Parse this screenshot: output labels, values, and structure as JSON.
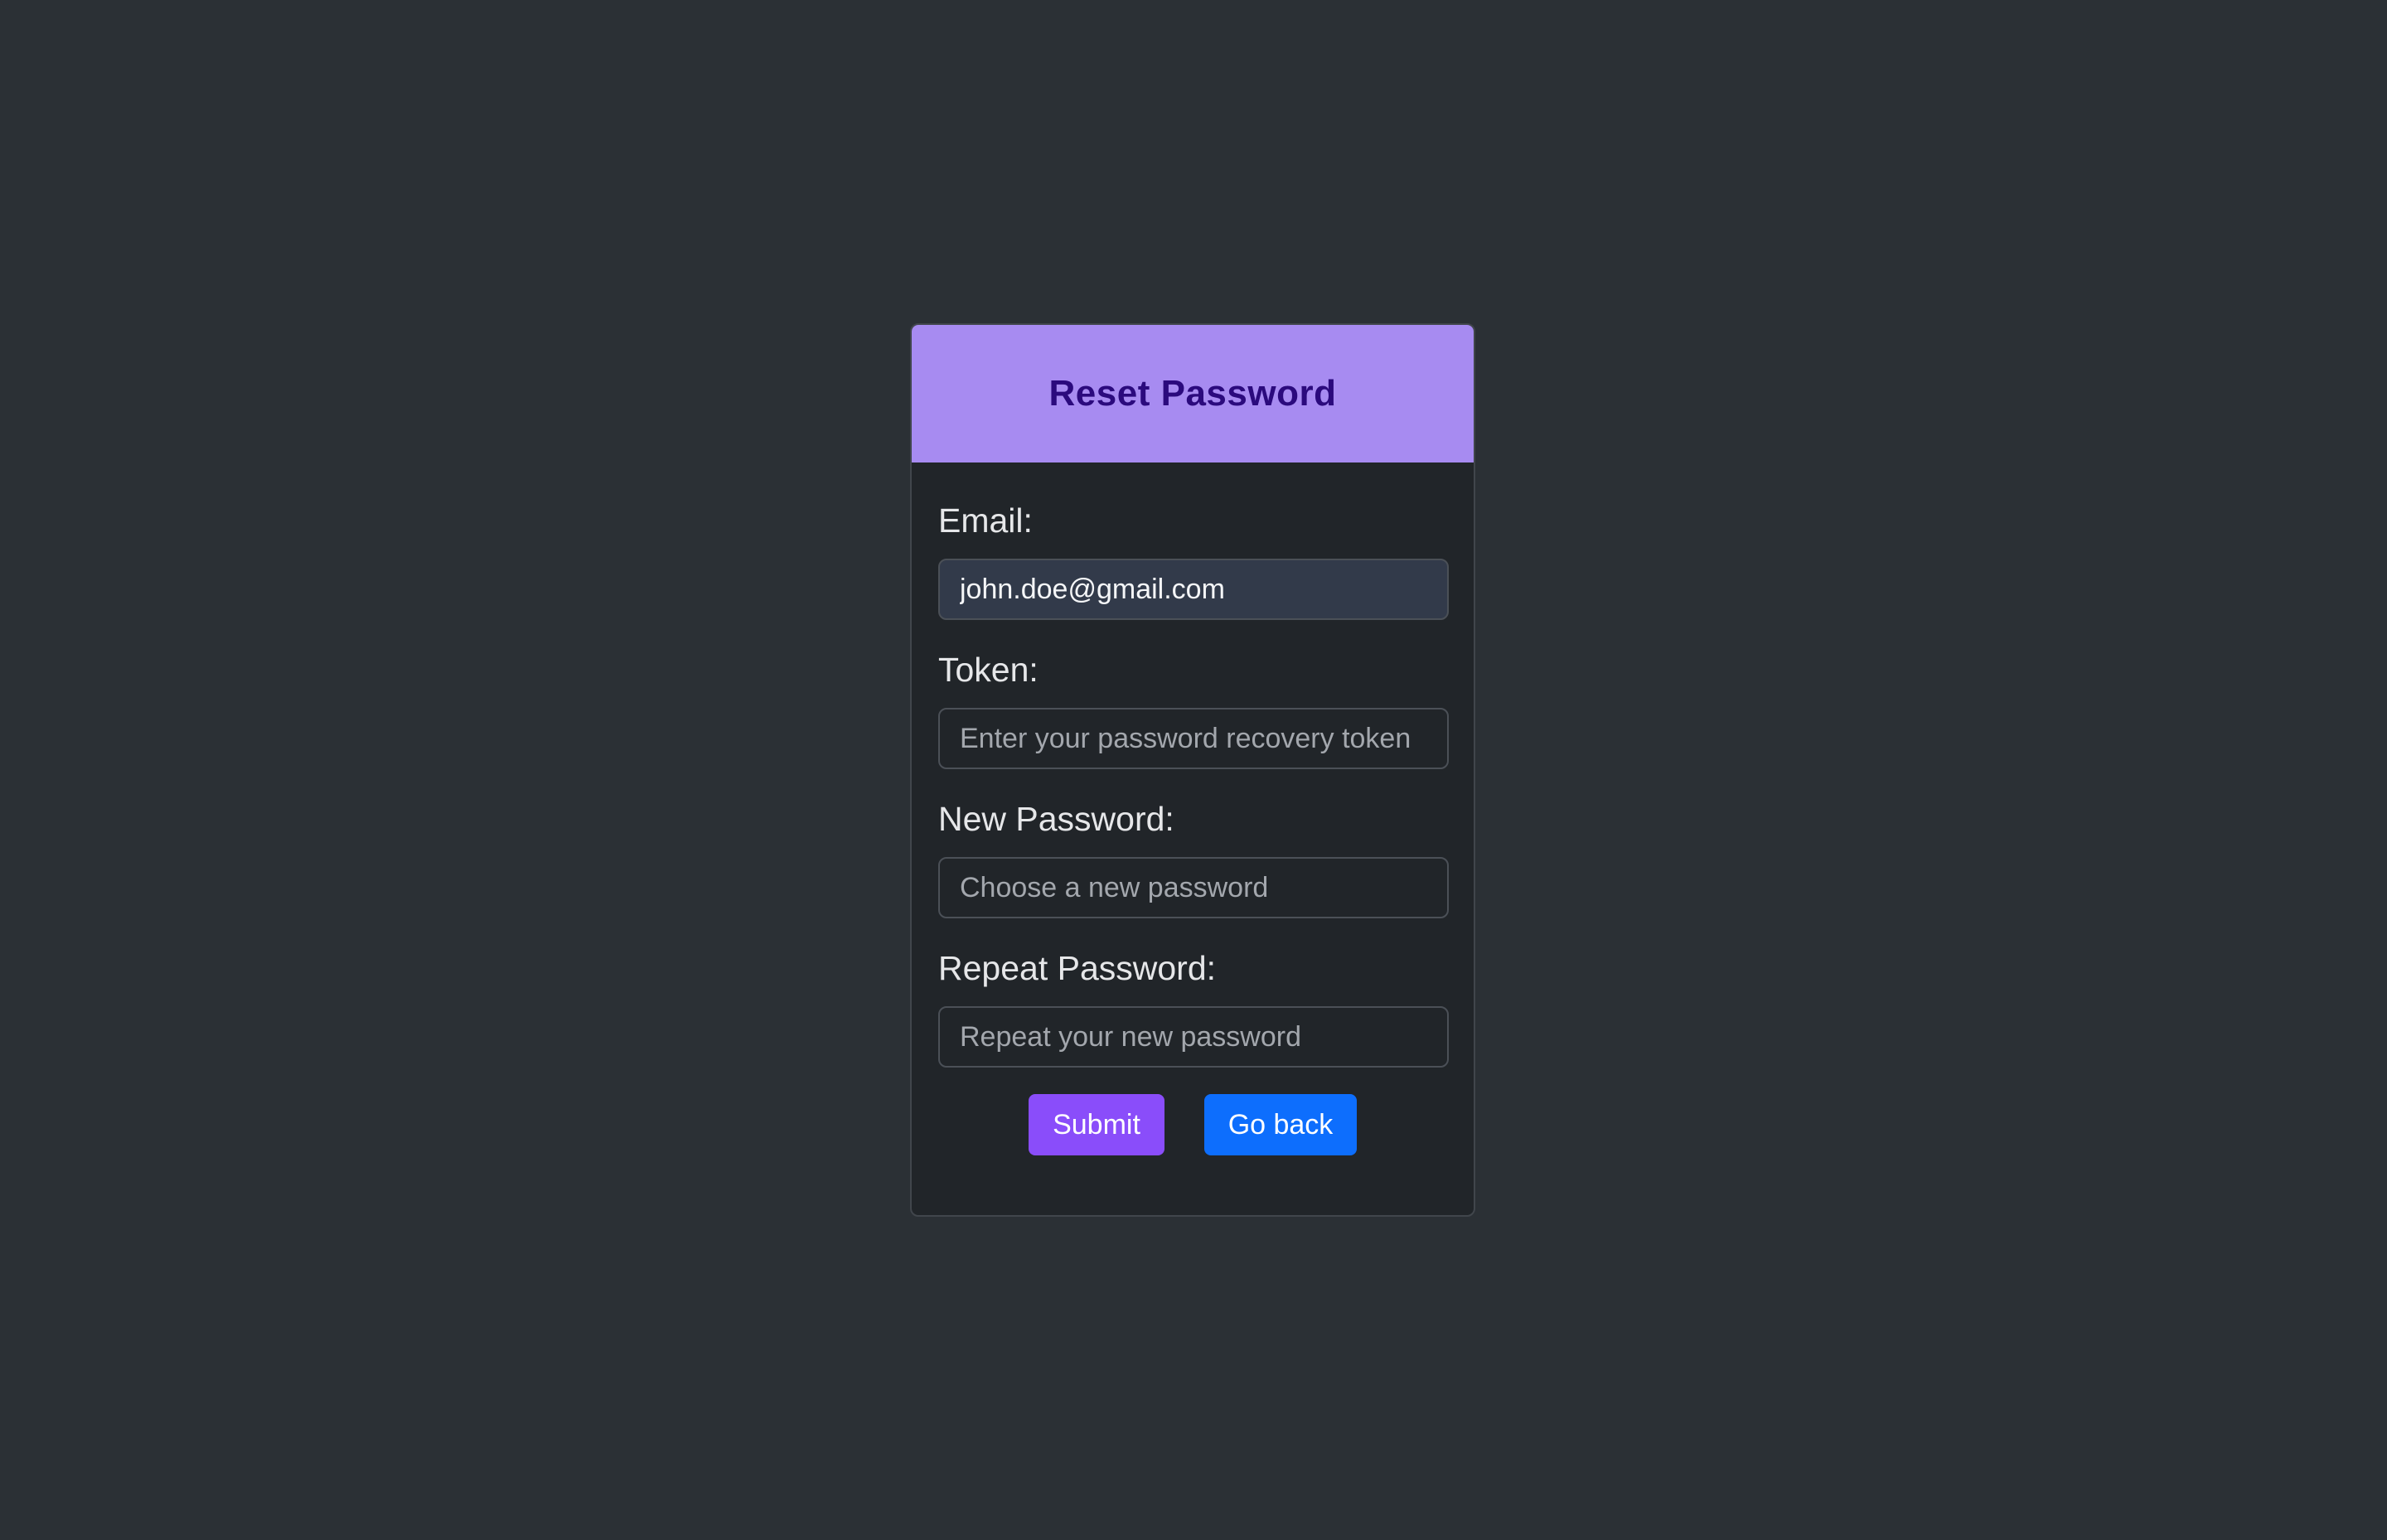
{
  "card": {
    "title": "Reset Password"
  },
  "form": {
    "email": {
      "label": "Email:",
      "value": "john.doe@gmail.com",
      "placeholder": ""
    },
    "token": {
      "label": "Token:",
      "value": "",
      "placeholder": "Enter your password recovery token"
    },
    "new_password": {
      "label": "New Password:",
      "value": "",
      "placeholder": "Choose a new password"
    },
    "repeat_password": {
      "label": "Repeat Password:",
      "value": "",
      "placeholder": "Repeat your new password"
    }
  },
  "actions": {
    "submit_label": "Submit",
    "back_label": "Go back"
  },
  "colors": {
    "page_background": "#2b3035",
    "card_background": "#212529",
    "header_background": "#a78bf1",
    "title_color": "#2b0a7d",
    "submit_button": "#8a4dfa",
    "back_button": "#0d6efd"
  }
}
